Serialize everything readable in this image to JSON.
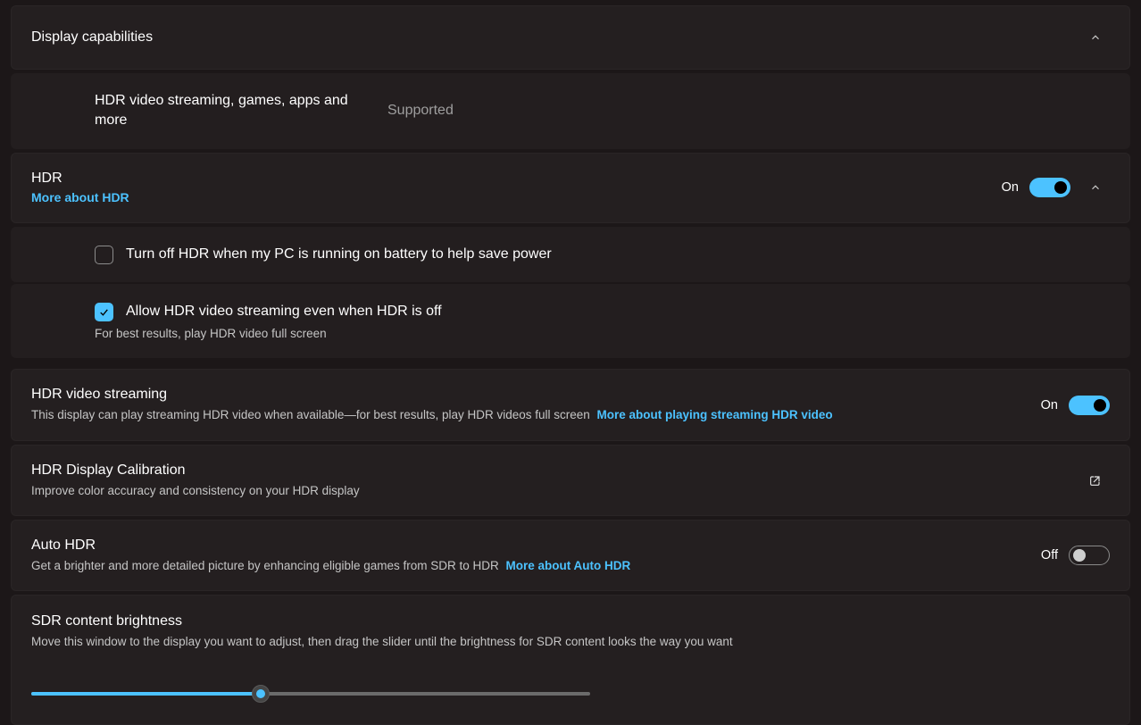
{
  "displayCapabilities": {
    "title": "Display capabilities",
    "rowLabel": "HDR video streaming, games, apps and more",
    "rowValue": "Supported"
  },
  "hdr": {
    "title": "HDR",
    "moreLink": "More about HDR",
    "toggleLabel": "On",
    "toggleOn": true,
    "batteryCheckbox": {
      "checked": false,
      "label": "Turn off HDR when my PC is running on battery to help save power"
    },
    "streamingCheckbox": {
      "checked": true,
      "label": "Allow HDR video streaming even when HDR is off",
      "hint": "For best results, play HDR video full screen"
    }
  },
  "hdrVideoStreaming": {
    "title": "HDR video streaming",
    "subtitle": "This display can play streaming HDR video when available—for best results, play HDR videos full screen",
    "moreLink": "More about playing streaming HDR video",
    "toggleLabel": "On",
    "toggleOn": true
  },
  "calibration": {
    "title": "HDR Display Calibration",
    "subtitle": "Improve color accuracy and consistency on your HDR display"
  },
  "autoHdr": {
    "title": "Auto HDR",
    "subtitle": "Get a brighter and more detailed picture by enhancing eligible games from SDR to HDR",
    "moreLink": "More about Auto HDR",
    "toggleLabel": "Off",
    "toggleOn": false
  },
  "sdrBrightness": {
    "title": "SDR content brightness",
    "subtitle": "Move this window to the display you want to adjust, then drag the slider until the brightness for SDR content looks the way you want",
    "sliderPercent": 41
  }
}
